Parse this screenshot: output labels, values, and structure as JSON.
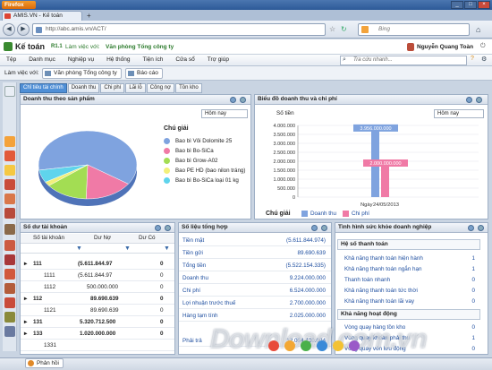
{
  "browser": {
    "app_name": "Firefox",
    "tab_title": "AMIS.VN - Kế toán",
    "url": "http://abc.amis.vn/ACT/",
    "search_placeholder": "Bing",
    "search_engine_icon": "bing-icon"
  },
  "app": {
    "title": "Kế toán",
    "version": "R1.1",
    "working_label": "Làm việc với:",
    "working_unit": "Văn phòng Tổng công ty",
    "user_name": "Nguyễn Quang Toàn",
    "menu": [
      "Tệp",
      "Danh mục",
      "Nghiệp vụ",
      "Hệ thống",
      "Tiện ích",
      "Cửa sổ",
      "Trợ giúp"
    ],
    "menu_search_placeholder": "Tra cứu nhanh...",
    "toolbar_label": "Làm việc với:",
    "toolbar_unit_button": "Văn phòng Tổng công ty",
    "toolbar_report_button": "Báo cáo"
  },
  "subtabs": [
    "Chỉ tiêu tài chính",
    "Doanh thu",
    "Chi phí",
    "Lãi lỗ",
    "Công nợ",
    "Tồn kho"
  ],
  "pie_panel": {
    "title": "Doanh thu theo sản phẩm",
    "period": "Hôm nay",
    "legend_title": "Chú giải",
    "legend": [
      {
        "label": "Bao bì Vôi Dolomite 25",
        "color": "#7fa3df"
      },
      {
        "label": "Bao bì Bo-SiCa",
        "color": "#f07aa6"
      },
      {
        "label": "Bao bì Grow-A02",
        "color": "#a3dd53"
      },
      {
        "label": "Bao PE HD (bao nilon tráng)",
        "color": "#f2f07b"
      },
      {
        "label": "Bao bì Bo-SiCa loại 01 kg",
        "color": "#5fd4ec"
      }
    ]
  },
  "bar_panel": {
    "title": "Biểu đồ doanh thu và chi phí",
    "period": "Hôm nay",
    "ylabel": "Số tiền",
    "yticks": [
      "4.000.000",
      "3.500.000",
      "3.000.000",
      "2.500.000",
      "2.000.000",
      "1.500.000",
      "1.000.000",
      "500.000",
      "0"
    ],
    "xlabel": "Ngày",
    "date": "24/05/2013",
    "legend_title": "Chú giải",
    "series_revenue": "Doanh thu",
    "series_cost": "Chi phí",
    "label_revenue": "3.956.000.000",
    "label_cost": "2.000.000.000"
  },
  "chart_data": {
    "type": "bar",
    "categories": [
      "24/05/2013"
    ],
    "series": [
      {
        "name": "Doanh thu",
        "values": [
          3956000
        ]
      },
      {
        "name": "Chi phí",
        "values": [
          2000000
        ]
      }
    ],
    "ylabel": "Số tiền",
    "xlabel": "Ngày",
    "ylim": [
      0,
      4000000
    ],
    "colors": [
      "#7fa3df",
      "#f07aa6"
    ]
  },
  "accounts_panel": {
    "title": "Số dư tài khoản",
    "col_account": "Số tài khoản",
    "col_debit": "Dư Nợ",
    "col_credit": "Dư Có",
    "rows": [
      {
        "acc": "111",
        "debit": "(5.611.844.97",
        "credit": "0"
      },
      {
        "acc": "1111",
        "debit": "(5.611.844.97",
        "credit": "0"
      },
      {
        "acc": "1112",
        "debit": "500.000.000",
        "credit": "0"
      },
      {
        "acc": "112",
        "debit": "89.690.639",
        "credit": "0"
      },
      {
        "acc": "1121",
        "debit": "89.690.639",
        "credit": "0"
      },
      {
        "acc": "131",
        "debit": "5.320.712.500",
        "credit": "0"
      },
      {
        "acc": "133",
        "debit": "1.020.000.000",
        "credit": "0"
      },
      {
        "acc": "1331",
        "debit": "",
        "credit": ""
      }
    ]
  },
  "summary_panel": {
    "title": "Số liệu tổng hợp",
    "rows": [
      {
        "label": "Tiền mặt",
        "value": "(5.611.844.974)"
      },
      {
        "label": "Tiền gửi",
        "value": "89.690.639"
      },
      {
        "label": "Tổng tiền",
        "value": "(5.522.154.335)"
      },
      {
        "label": "Doanh thu",
        "value": "9.224.000.000"
      },
      {
        "label": "Chi phí",
        "value": "6.524.000.000"
      },
      {
        "label": "Lợi nhuận trước thuế",
        "value": "2.700.000.000"
      },
      {
        "label": "Hàng tạm tính",
        "value": "2.025.000.000"
      },
      {
        "label": "Phải trả",
        "value": "12.054.430.004"
      }
    ]
  },
  "health_panel": {
    "title": "Tình hình sức khỏe doanh nghiệp",
    "section1": "Hệ số thanh toán",
    "items1": [
      {
        "label": "Khả năng thanh toán hiện hành",
        "value": "1"
      },
      {
        "label": "Khả năng thanh toán ngắn hạn",
        "value": "1"
      },
      {
        "label": "Thanh toán nhanh",
        "value": "0"
      },
      {
        "label": "Khả năng thanh toán tức thời",
        "value": "0"
      },
      {
        "label": "Khả năng thanh toán lãi vay",
        "value": "0"
      }
    ],
    "section2": "Khả năng hoạt động",
    "items2": [
      {
        "label": "Vòng quay hàng tồn kho",
        "value": "0"
      },
      {
        "label": "Vòng quay khoản phải thu",
        "value": "1"
      },
      {
        "label": "Vòng quay vốn lưu động",
        "value": "0"
      }
    ]
  },
  "status": {
    "feedback": "Phản hồi"
  },
  "watermark": "Download.com.vn"
}
